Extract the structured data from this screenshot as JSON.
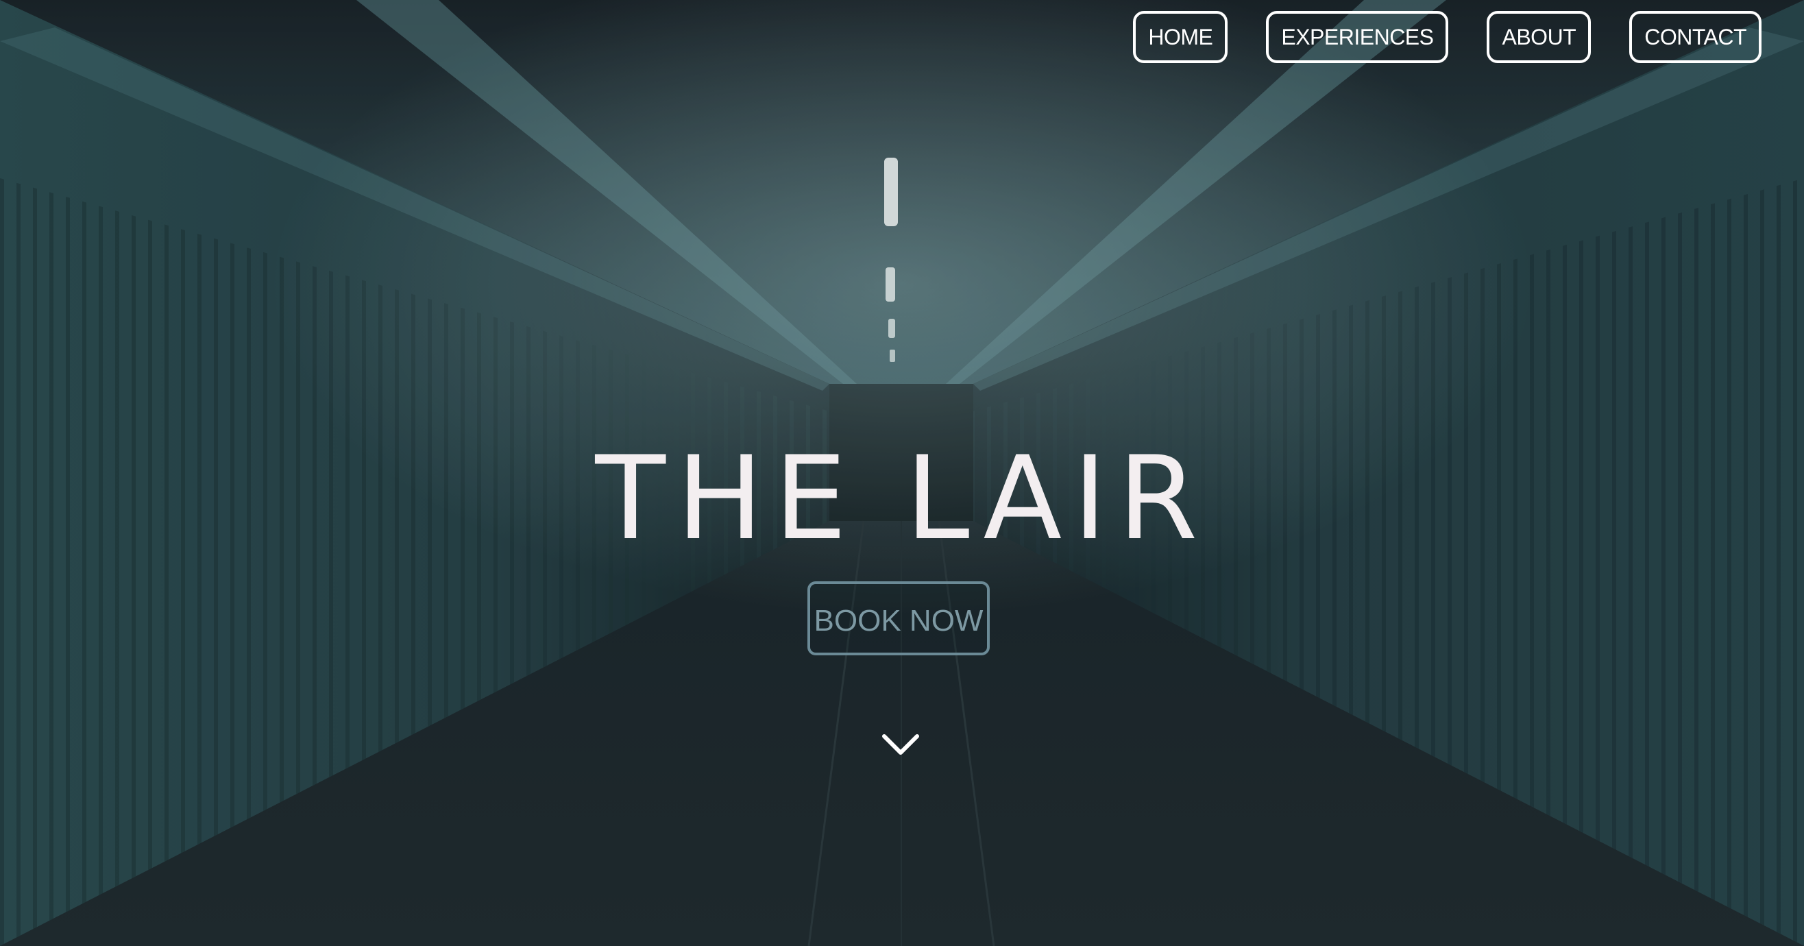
{
  "nav": {
    "items": [
      {
        "label": "HOME"
      },
      {
        "label": "EXPERIENCES"
      },
      {
        "label": "ABOUT"
      },
      {
        "label": "CONTACT"
      }
    ]
  },
  "hero": {
    "title": "THE LAIR",
    "cta_label": "BOOK NOW",
    "scroll_icon": "chevron-down-icon",
    "background": "dark-teal-tunnel-corridor-photo"
  },
  "colors": {
    "accent_text": "#f3eef0",
    "cta_border": "#6b8a96",
    "tunnel_teal": "#3f6b72"
  }
}
